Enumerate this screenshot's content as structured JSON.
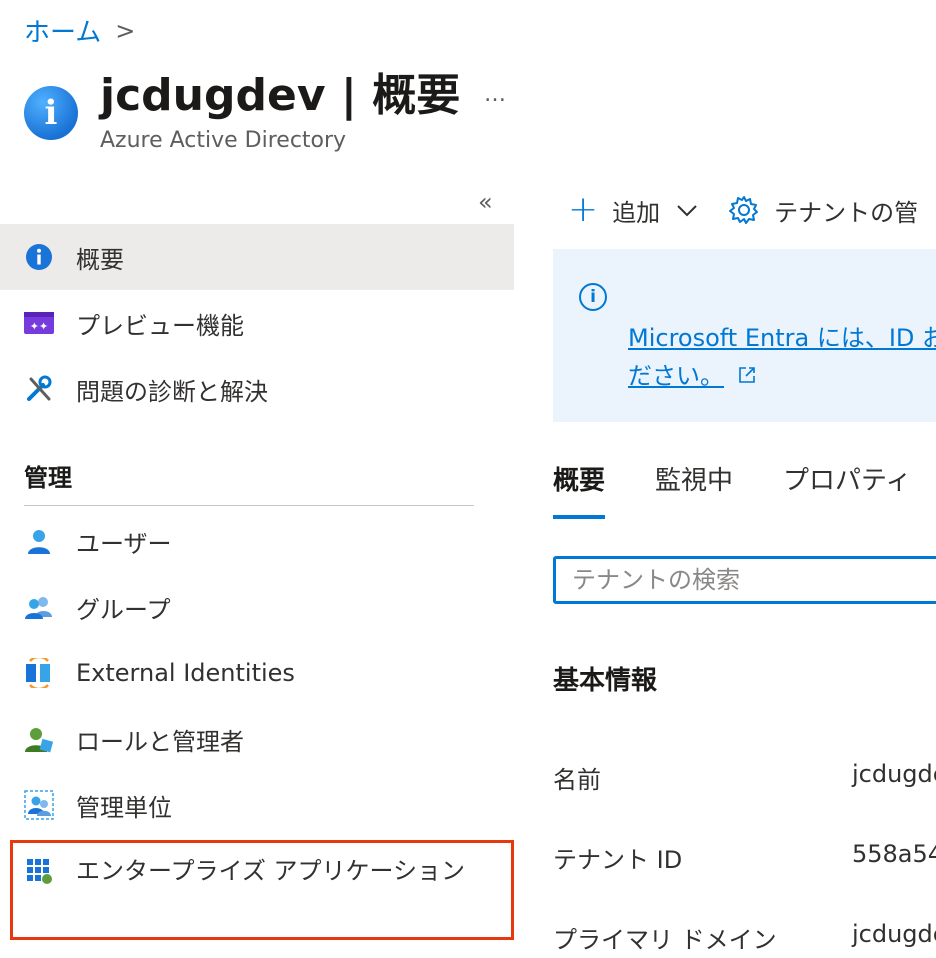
{
  "breadcrumb": {
    "home": "ホーム",
    "separator": ">"
  },
  "header": {
    "title": "jcdugdev | 概要",
    "subtitle": "Azure Active Directory",
    "more": "…",
    "icon": "info-circle-icon"
  },
  "sidebar": {
    "collapse": "«",
    "items": [
      {
        "label": "概要",
        "icon": "info-icon",
        "active": true
      },
      {
        "label": "プレビュー機能",
        "icon": "preview-features-icon"
      },
      {
        "label": "問題の診断と解決",
        "icon": "wrench-screwdriver-icon"
      }
    ],
    "section_label": "管理",
    "manage_items": [
      {
        "label": "ユーザー",
        "icon": "user-icon"
      },
      {
        "label": "グループ",
        "icon": "group-icon"
      },
      {
        "label": "External Identities",
        "icon": "external-identities-icon"
      },
      {
        "label": "ロールと管理者",
        "icon": "roles-admins-icon"
      },
      {
        "label": "管理単位",
        "icon": "admin-units-icon"
      },
      {
        "label": "エンタープライズ アプリケーション",
        "icon": "enterprise-apps-icon",
        "highlighted": true
      }
    ]
  },
  "toolbar": {
    "add": "追加",
    "tenant_manage": "テナントの管"
  },
  "banner": {
    "line1": "Microsoft Entra には、ID お",
    "line2": "ださい。"
  },
  "tabs": [
    "概要",
    "監視中",
    "プロパティ"
  ],
  "search": {
    "placeholder": "テナントの検索"
  },
  "basic_info": {
    "title": "基本情報",
    "rows": [
      {
        "label": "名前",
        "value": "jcdugde"
      },
      {
        "label": "テナント ID",
        "value": "558a54"
      },
      {
        "label": "プライマリ ドメイン",
        "value": "jcdugde"
      }
    ]
  },
  "colors": {
    "accent": "#0078d4",
    "highlight_border": "#e8380d",
    "active_bg": "#edebe9",
    "banner_bg": "#ebf3fc"
  }
}
